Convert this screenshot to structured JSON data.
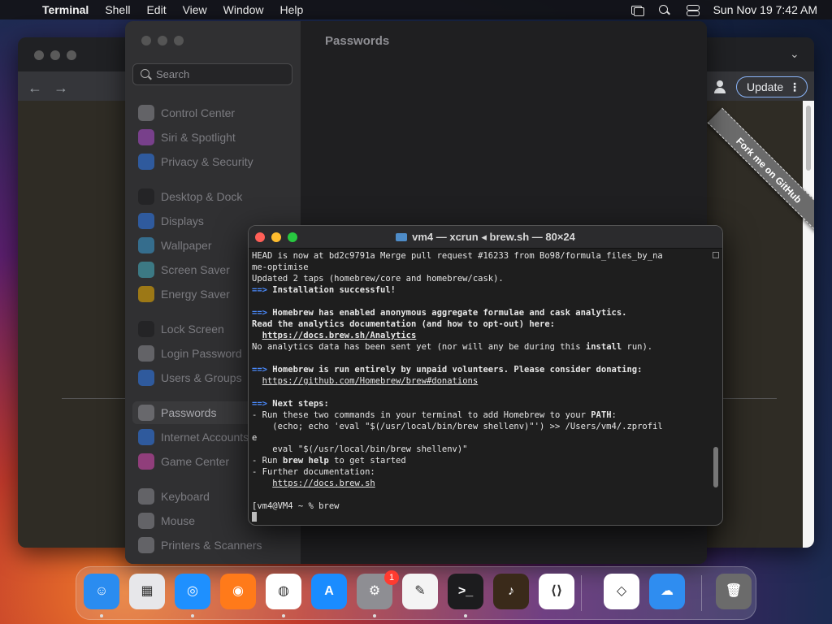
{
  "menubar": {
    "app_name": "Terminal",
    "items": [
      "Shell",
      "Edit",
      "View",
      "Window",
      "Help"
    ],
    "clock": "Sun Nov 19  7:42 AM"
  },
  "browser": {
    "update_label": "Update",
    "update_more": "⋮",
    "ribbon_text": "Fork me on GitHub",
    "back_arrow": "←",
    "forward_arrow": "→",
    "chevron": "⌄"
  },
  "settings": {
    "search_placeholder": "Search",
    "page_title": "Passwords",
    "sidebar_items": [
      {
        "label": "Control Center",
        "color": "#8e8e93"
      },
      {
        "label": "Siri & Spotlight",
        "color": "#b44fd6"
      },
      {
        "label": "Privacy & Security",
        "color": "#2f7df6"
      },
      {
        "label": "Desktop & Dock",
        "color": "#1c1c1e"
      },
      {
        "label": "Displays",
        "color": "#2f7df6"
      },
      {
        "label": "Wallpaper",
        "color": "#3aa0d8"
      },
      {
        "label": "Screen Saver",
        "color": "#47b6c9"
      },
      {
        "label": "Energy Saver",
        "color": "#f5b400"
      },
      {
        "label": "Lock Screen",
        "color": "#1c1c1e"
      },
      {
        "label": "Login Password",
        "color": "#8e8e93"
      },
      {
        "label": "Users & Groups",
        "color": "#2f7df6"
      },
      {
        "label": "Passwords",
        "color": "#8e8e93"
      },
      {
        "label": "Internet Accounts",
        "color": "#2f7df6"
      },
      {
        "label": "Game Center",
        "color": "#e04ab8"
      },
      {
        "label": "Keyboard",
        "color": "#8e8e93"
      },
      {
        "label": "Mouse",
        "color": "#8e8e93"
      },
      {
        "label": "Printers & Scanners",
        "color": "#8e8e93"
      }
    ],
    "selected_item": "Passwords"
  },
  "terminal": {
    "title": "vm4 — xcrun ◂ brew.sh — 80×24",
    "lines": [
      [
        {
          "t": "HEAD is now at bd2c9791a Merge pull request #16233 from Bo98/formula_files_by_na"
        }
      ],
      [
        {
          "t": "me-optimise"
        }
      ],
      [
        {
          "t": "Updated 2 taps (homebrew/core and homebrew/cask)."
        }
      ],
      [
        {
          "t": "==>",
          "s": "arrow"
        },
        {
          "t": " Installation successful!",
          "s": "b"
        }
      ],
      [
        {
          "t": ""
        }
      ],
      [
        {
          "t": "==>",
          "s": "arrow"
        },
        {
          "t": " Homebrew has enabled anonymous aggregate formulae and cask analytics.",
          "s": "b"
        }
      ],
      [
        {
          "t": "Read the analytics documentation (and how to opt-out) here:",
          "s": "b"
        }
      ],
      [
        {
          "t": "  "
        },
        {
          "t": "https://docs.brew.sh/Analytics",
          "s": "b u"
        }
      ],
      [
        {
          "t": "No analytics data has been sent yet (nor will any be during this "
        },
        {
          "t": "install",
          "s": "b"
        },
        {
          "t": " run)."
        }
      ],
      [
        {
          "t": ""
        }
      ],
      [
        {
          "t": "==>",
          "s": "arrow"
        },
        {
          "t": " Homebrew is run entirely by unpaid volunteers. Please consider donating:",
          "s": "b"
        }
      ],
      [
        {
          "t": "  "
        },
        {
          "t": "https://github.com/Homebrew/brew#donations",
          "s": "u"
        }
      ],
      [
        {
          "t": ""
        }
      ],
      [
        {
          "t": "==>",
          "s": "arrow"
        },
        {
          "t": " Next steps:",
          "s": "b"
        }
      ],
      [
        {
          "t": "- Run these two commands in your terminal to add Homebrew to your "
        },
        {
          "t": "PATH",
          "s": "b"
        },
        {
          "t": ":"
        }
      ],
      [
        {
          "t": "    (echo; echo 'eval \"$(/usr/local/bin/brew shellenv)\"') >> /Users/vm4/.zprofil"
        }
      ],
      [
        {
          "t": "e"
        }
      ],
      [
        {
          "t": "    eval \"$(/usr/local/bin/brew shellenv)\""
        }
      ],
      [
        {
          "t": "- Run "
        },
        {
          "t": "brew help",
          "s": "b"
        },
        {
          "t": " to get started"
        }
      ],
      [
        {
          "t": "- Further documentation:"
        }
      ],
      [
        {
          "t": "    "
        },
        {
          "t": "https://docs.brew.sh",
          "s": "u"
        }
      ],
      [
        {
          "t": ""
        }
      ],
      [
        {
          "t": "[vm4@VM4 ~ % brew"
        }
      ]
    ],
    "scroll_position": 0.85
  },
  "dock": {
    "apps": [
      {
        "name": "finder",
        "color": "#2a8cf0",
        "glyph": "☺",
        "running": true
      },
      {
        "name": "launchpad",
        "color": "#e7e7ea",
        "glyph": "▦",
        "running": false
      },
      {
        "name": "safari",
        "color": "#1e90ff",
        "glyph": "◎",
        "running": true
      },
      {
        "name": "firefox",
        "color": "#ff7a1a",
        "glyph": "◉",
        "running": false
      },
      {
        "name": "chrome",
        "color": "#ffffff",
        "glyph": "◍",
        "running": true
      },
      {
        "name": "app-store",
        "color": "#1a8cff",
        "glyph": "A",
        "running": false
      },
      {
        "name": "system-settings",
        "color": "#8e8e93",
        "glyph": "⚙",
        "running": true,
        "badge": "1"
      },
      {
        "name": "textedit",
        "color": "#f4f4f4",
        "glyph": "✎",
        "running": false
      },
      {
        "name": "terminal",
        "color": "#1c1c1e",
        "glyph": ">_",
        "running": true
      },
      {
        "name": "garageband",
        "color": "#3a2a1a",
        "glyph": "♪",
        "running": false
      },
      {
        "name": "vscode",
        "color": "#ffffff",
        "glyph": "⟨⟩",
        "running": false
      },
      {
        "name": "visual-studio",
        "color": "#ffffff",
        "glyph": "◇",
        "running": false
      },
      {
        "name": "weather",
        "color": "#2f8df0",
        "glyph": "☁",
        "running": false
      },
      {
        "name": "trash",
        "color": "#6b6b6b",
        "glyph": "🗑",
        "running": false
      }
    ]
  }
}
